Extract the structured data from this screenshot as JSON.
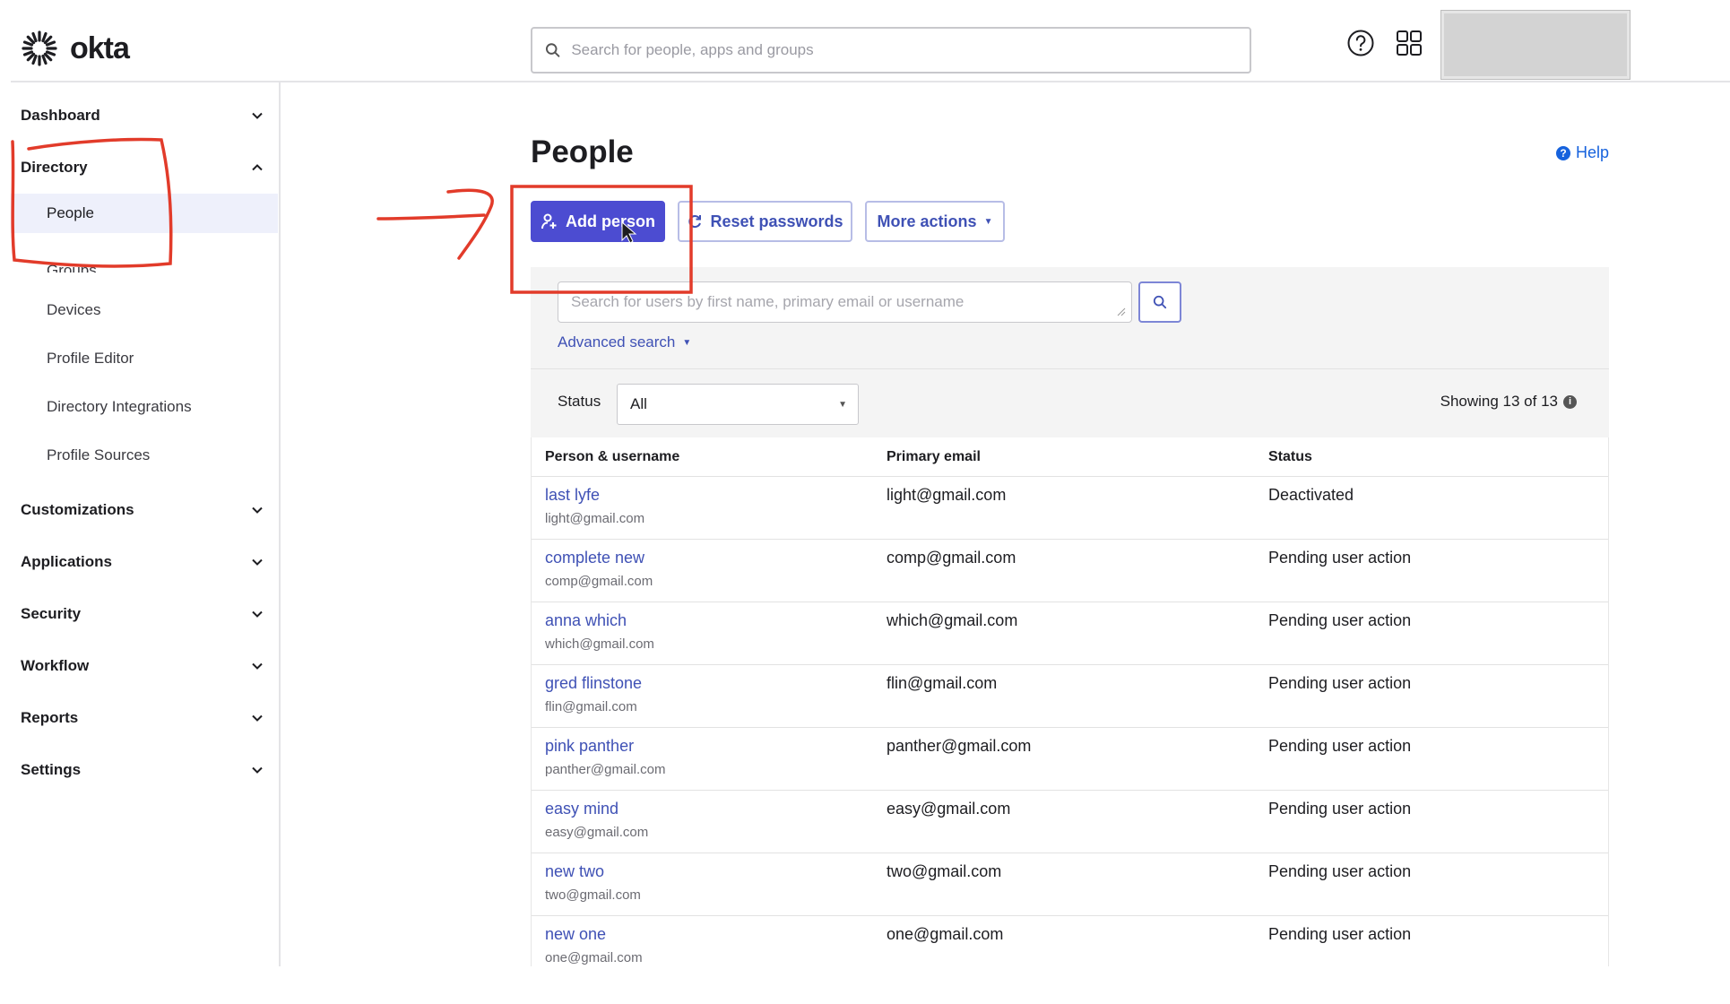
{
  "header": {
    "logo_text": "okta",
    "search_placeholder": "Search for people, apps and groups",
    "icons": [
      "help-icon",
      "apps-grid-icon"
    ]
  },
  "sidebar": {
    "sections": [
      {
        "label": "Dashboard",
        "expanded": false
      },
      {
        "label": "Directory",
        "expanded": true
      },
      {
        "label": "Customizations",
        "expanded": false
      },
      {
        "label": "Applications",
        "expanded": false
      },
      {
        "label": "Security",
        "expanded": false
      },
      {
        "label": "Workflow",
        "expanded": false
      },
      {
        "label": "Reports",
        "expanded": false
      },
      {
        "label": "Settings",
        "expanded": false
      }
    ],
    "directory_items": [
      {
        "label": "People",
        "active": true
      },
      {
        "label": "Groups",
        "active": false
      },
      {
        "label": "Devices",
        "active": false
      },
      {
        "label": "Profile Editor",
        "active": false
      },
      {
        "label": "Directory Integrations",
        "active": false
      },
      {
        "label": "Profile Sources",
        "active": false
      }
    ]
  },
  "main": {
    "title": "People",
    "help_label": "Help",
    "buttons": {
      "add_person": "Add person",
      "reset_passwords": "Reset passwords",
      "more_actions": "More actions"
    },
    "user_search_placeholder": "Search for users by first name, primary email or username",
    "advanced_search": "Advanced search",
    "status_label": "Status",
    "status_value": "All",
    "showing": "Showing 13 of 13",
    "table": {
      "columns": [
        "Person & username",
        "Primary email",
        "Status"
      ],
      "rows": [
        {
          "name": "last lyfe",
          "username": "light@gmail.com",
          "email": "light@gmail.com",
          "status": "Deactivated"
        },
        {
          "name": "complete new",
          "username": "comp@gmail.com",
          "email": "comp@gmail.com",
          "status": "Pending user action"
        },
        {
          "name": "anna which",
          "username": "which@gmail.com",
          "email": "which@gmail.com",
          "status": "Pending user action"
        },
        {
          "name": "gred flinstone",
          "username": "flin@gmail.com",
          "email": "flin@gmail.com",
          "status": "Pending user action"
        },
        {
          "name": "pink panther",
          "username": "panther@gmail.com",
          "email": "panther@gmail.com",
          "status": "Pending user action"
        },
        {
          "name": "easy mind",
          "username": "easy@gmail.com",
          "email": "easy@gmail.com",
          "status": "Pending user action"
        },
        {
          "name": "new two",
          "username": "two@gmail.com",
          "email": "two@gmail.com",
          "status": "Pending user action"
        },
        {
          "name": "new one",
          "username": "one@gmail.com",
          "email": "one@gmail.com",
          "status": "Pending user action"
        }
      ]
    }
  },
  "colors": {
    "primary": "#4c4cd1",
    "link": "#3f51b5",
    "annotation": "#e23b2a"
  }
}
